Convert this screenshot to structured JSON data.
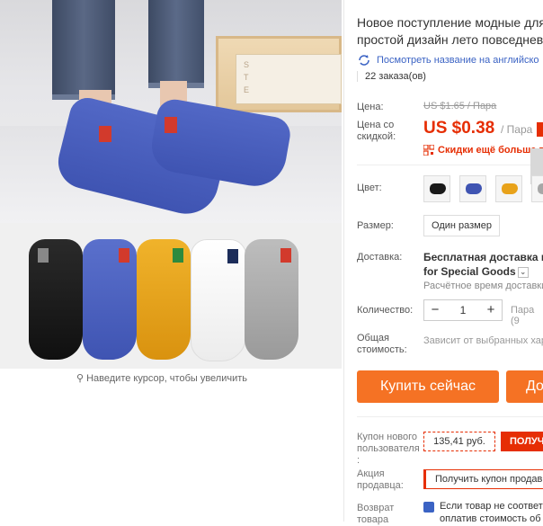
{
  "gallery": {
    "zoom_hint": "Наведите курсор, чтобы увеличить",
    "box_letters": [
      "S",
      "T",
      "E"
    ]
  },
  "product": {
    "title_line1": "Новое поступление модные для м",
    "title_line2": "простой дизайн лето повседневны",
    "translate_link": "Посмотреть название на английско",
    "orders": "22 заказа(ов)"
  },
  "price": {
    "label": "Цена:",
    "old": "US $1.65 / Пара",
    "discount_label_line1": "Цена со",
    "discount_label_line2": "скидкой:",
    "current": "US $0.38",
    "unit": "/ Пара",
    "coupon_link": "Скидки ещё больше в п"
  },
  "options": {
    "color_label": "Цвет:",
    "swatches": [
      {
        "name": "black",
        "color": "#1a1a1a"
      },
      {
        "name": "blue",
        "color": "#3f54b2"
      },
      {
        "name": "yellow",
        "color": "#e8a21a"
      },
      {
        "name": "gray",
        "color": "#a7a7a7"
      }
    ],
    "size_label": "Размер:",
    "size_value": "Один размер"
  },
  "shipping": {
    "label": "Доставка:",
    "line1": "Бесплатная доставка в R",
    "line2": "for Special Goods",
    "estimate": "Расчётное время доставки"
  },
  "quantity": {
    "label": "Количество:",
    "minus": "−",
    "value": "1",
    "plus": "+",
    "unit": "Пара (9"
  },
  "total": {
    "label_line1": "Общая",
    "label_line2": "стоимость:",
    "value": "Зависит от выбранных хар"
  },
  "actions": {
    "buy": "Купить сейчас",
    "cart": "До"
  },
  "coupons": {
    "new_user_label": [
      "Купон нового",
      "пользователя",
      ":"
    ],
    "new_user_amount": "135,41 руб.",
    "new_user_get": "ПОЛУЧ",
    "seller_label": [
      "Акция",
      "продавца:"
    ],
    "seller_promo": "Получить купон продав",
    "return_label": [
      "Возврат",
      "товара"
    ],
    "return_line1": "Если товар не соответс",
    "return_line2": "оплатив стоимость об"
  },
  "colors": {
    "accent": "#e62e04",
    "button": "#f57224",
    "link": "#3b63c4"
  }
}
